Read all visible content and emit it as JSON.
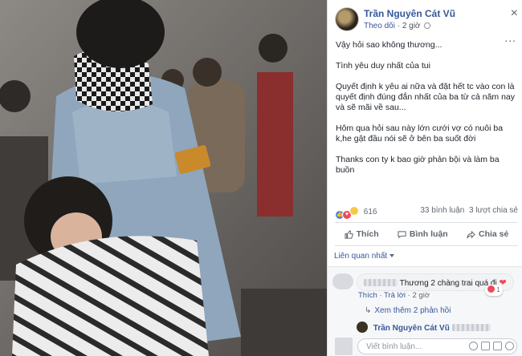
{
  "post": {
    "author": "Trần Nguyên Cát Vũ",
    "follow_label": "Theo dõi",
    "time": "2 giờ",
    "close_glyph": "×",
    "more_glyph": "...",
    "paragraphs": [
      "Vậy hỏi sao không thương...",
      "Tình yêu duy nhất của tui",
      "Quyết định k yêu ai nữa và đặt hết tc vào con là quyết định đúng đắn nhất của ba từ cả năm nay và sẽ mãi về sau...",
      "Hôm qua hỏi sau này lớn cưới vợ có nuôi ba k,he gật đầu nói sẽ ở bên ba suốt đời",
      "Thanks con ty k bao giờ phản bội và làm ba buồn"
    ]
  },
  "reactions": {
    "count": "616",
    "comments": "33 bình luận",
    "shares": "3 lượt chia sẻ",
    "icons": [
      "like-icon",
      "love-icon",
      "haha-icon"
    ]
  },
  "actions": {
    "like": "Thích",
    "comment": "Bình luận",
    "share": "Chia sẻ"
  },
  "comments_section": {
    "sort_label": "Liên quan nhất",
    "comment": {
      "text": "Thương 2 chàng trai quá đi",
      "like": "Thích",
      "reply": "Trả lời",
      "time": "2 giờ",
      "reaction_count": "1"
    },
    "view_more": "Xem thêm 2 phản hồi",
    "reply_author": "Trần Nguyên Cát Vũ",
    "input_placeholder": "Viết bình luận..."
  },
  "colors": {
    "link": "#365899",
    "love": "#f0485c",
    "like": "#4a7ee8"
  }
}
